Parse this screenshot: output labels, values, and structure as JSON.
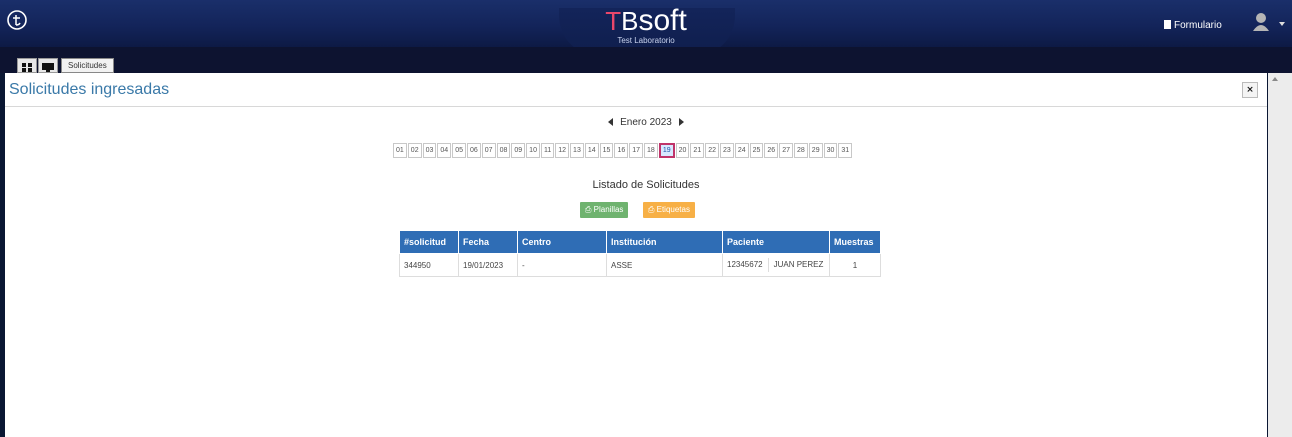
{
  "app": {
    "brand_tb1": "T",
    "brand_tb2": "B",
    "brand_soft": "soft",
    "subtitle": "Test Laboratorio",
    "formulario": "Formulario"
  },
  "tabs": {
    "solicitudes": "Solicitudes"
  },
  "panel": {
    "title": "Solicitudes ingresadas",
    "close": "×"
  },
  "calendar": {
    "month": "Enero 2023",
    "selected_day": "19",
    "days": [
      "01",
      "02",
      "03",
      "04",
      "05",
      "06",
      "07",
      "08",
      "09",
      "10",
      "11",
      "12",
      "13",
      "14",
      "15",
      "16",
      "17",
      "18",
      "19",
      "20",
      "21",
      "22",
      "23",
      "24",
      "25",
      "26",
      "27",
      "28",
      "29",
      "30",
      "31"
    ]
  },
  "listado": {
    "title": "Listado de Solicitudes",
    "planillas": "Planillas",
    "etiquetas": "Etiquetas"
  },
  "table": {
    "headers": [
      "#solicitud",
      "Fecha",
      "Centro",
      "Institución",
      "Paciente",
      "Muestras"
    ],
    "rows": [
      {
        "solicitud": "344950",
        "fecha": "19/01/2023",
        "centro": "-",
        "institucion": "ASSE",
        "paciente_id": "12345672",
        "paciente_nombre": "JUAN PEREZ",
        "muestras": "1"
      }
    ]
  },
  "colors": {
    "header_blue": "#2f6db5",
    "accent_pink": "#c0346a",
    "button_green": "#6fb36f",
    "button_orange": "#f7b046"
  }
}
